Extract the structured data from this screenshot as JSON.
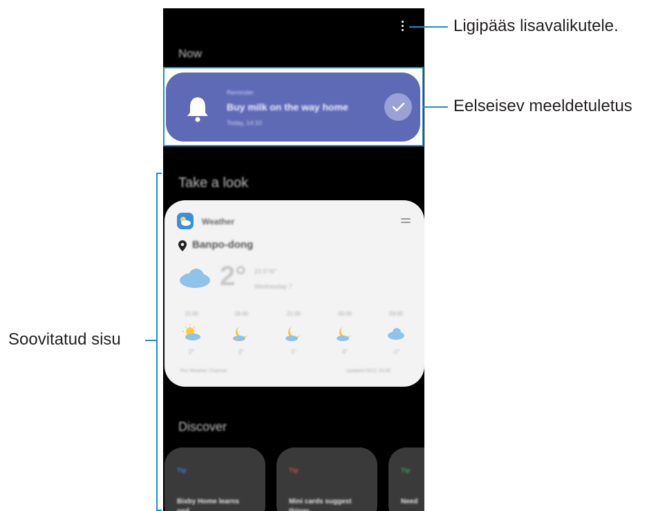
{
  "screen": {
    "sections": {
      "now": "Now",
      "take_a_look": "Take a look",
      "discover": "Discover"
    },
    "reminder": {
      "category": "Reminder",
      "title": "Buy milk on the way home",
      "time": "Today, 14:10",
      "icon": "bell-icon",
      "color": "#5f6ab7"
    },
    "weather": {
      "app_name": "Weather",
      "location": "Banpo-dong",
      "temperature": "2°",
      "feels_like": "23.5°/6°",
      "date": "Wednesday 7",
      "hours": [
        {
          "time": "15:00",
          "temp": "2°",
          "icon": "sun-cloud-icon"
        },
        {
          "time": "18:00",
          "temp": "2°",
          "icon": "moon-icon"
        },
        {
          "time": "21:00",
          "temp": "1°",
          "icon": "moon-icon"
        },
        {
          "time": "00:00",
          "temp": "0°",
          "icon": "moon-icon"
        },
        {
          "time": "03:00",
          "temp": "-1°",
          "icon": "cloud-icon"
        }
      ],
      "source": "The Weather Channel",
      "updated": "Updated 03/11 15:05"
    },
    "discover_cards": [
      {
        "tag": "Tip",
        "tag_color": "#4a78d4",
        "title": "Bixby Home learns and"
      },
      {
        "tag": "Tip",
        "tag_color": "#c8504b",
        "title": "Mini cards suggest things"
      },
      {
        "tag": "Tip",
        "tag_color": "#3aa061",
        "title": "Need"
      }
    ]
  },
  "callouts": {
    "more_options": "Ligipääs lisavalikutele.",
    "upcoming_reminder": "Eelseisev meeldetuletus",
    "recommended_content": "Soovitatud sisu"
  },
  "colors": {
    "callout_line": "#1b8fc9",
    "background": "#000000",
    "card": "#f3f3f3"
  }
}
